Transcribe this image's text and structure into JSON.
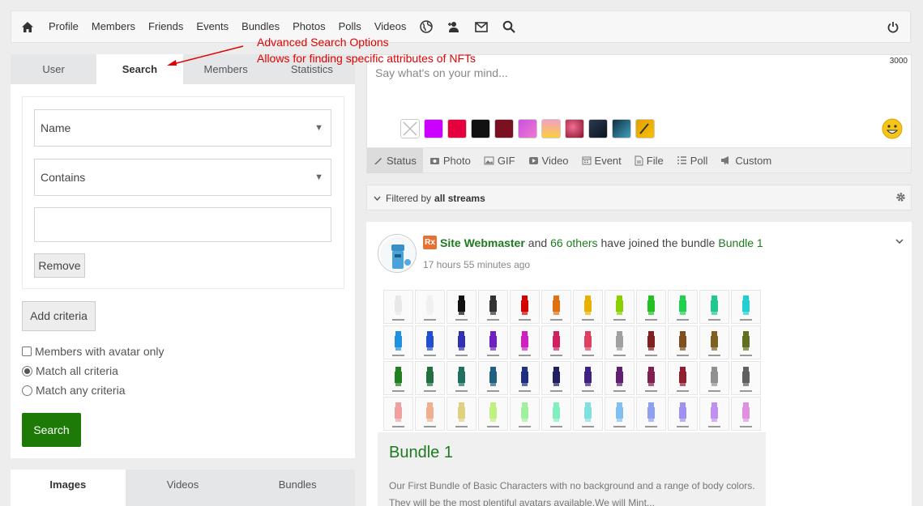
{
  "nav": {
    "links": [
      "Profile",
      "Members",
      "Friends",
      "Events",
      "Bundles",
      "Photos",
      "Polls",
      "Videos"
    ],
    "icons": [
      "home-icon",
      "globe-icon",
      "person-add-icon",
      "envelope-icon",
      "search-icon",
      "power-icon"
    ]
  },
  "annotation": {
    "line1": "Advanced Search Options",
    "line2": "Allows for finding specific attributes of NFTs",
    "color": "#e30000"
  },
  "left_tabs": [
    "User",
    "Search",
    "Members",
    "Statistics"
  ],
  "search_form": {
    "field_select": "Name",
    "operator_select": "Contains",
    "value": "",
    "remove_label": "Remove",
    "add_criteria_label": "Add criteria",
    "avatar_only_label": "Members with avatar only",
    "match_all_label": "Match all criteria",
    "match_any_label": "Match any criteria",
    "search_label": "Search"
  },
  "media_tabs": [
    "Images",
    "Videos",
    "Bundles"
  ],
  "composer": {
    "placeholder": "Say what's on your mind...",
    "char_limit": "3000",
    "tabs": [
      "Status",
      "Photo",
      "GIF",
      "Video",
      "Event",
      "File",
      "Poll",
      "Custom"
    ]
  },
  "filter": {
    "prefix": "Filtered by",
    "value": "all streams"
  },
  "post": {
    "author": "Site Webmaster",
    "connector": "and",
    "others": "66 others",
    "action": "have joined the bundle",
    "bundle": "Bundle 1",
    "time": "17 hours 55 minutes ago",
    "card_title": "Bundle 1",
    "card_desc": "Our First Bundle of Basic Characters with no background and a range of body colors. They will be the most plentiful avatars available.We will Mint..."
  },
  "colors": {
    "accent_green": "#1d7a06",
    "link_green": "#1e7a1e"
  }
}
